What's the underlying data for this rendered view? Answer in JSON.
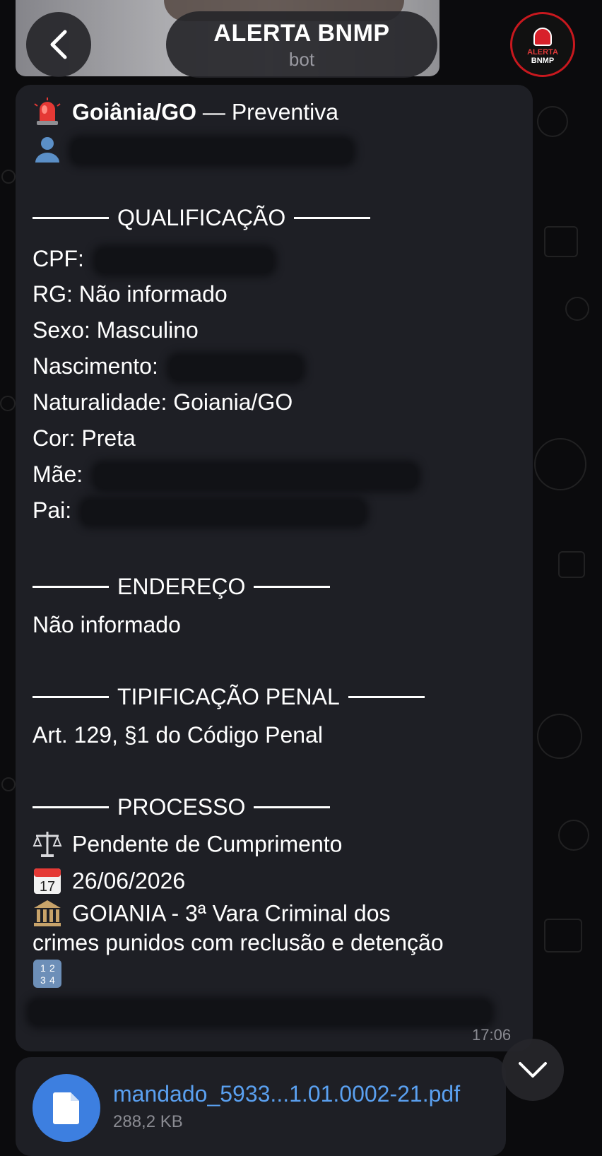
{
  "header": {
    "title": "ALERTA BNMP",
    "subtitle": "bot",
    "avatar_line1": "ALERTA",
    "avatar_line2": "BNMP",
    "back_icon": "chevron-left-icon"
  },
  "message": {
    "headline_city": "Goiânia/GO",
    "headline_rest": " — Preventiva",
    "sections": {
      "qualificacao": "QUALIFICAÇÃO",
      "endereco": "ENDEREÇO",
      "tipificacao": "TIPIFICAÇÃO PENAL",
      "processo": "PROCESSO"
    },
    "fields": {
      "cpf_label": "CPF:",
      "rg": "RG: Não informado",
      "sexo": "Sexo: Masculino",
      "nascimento_label": "Nascimento:",
      "naturalidade": "Naturalidade: Goiania/GO",
      "cor": "Cor: Preta",
      "mae_label": "Mãe:",
      "pai_label": "Pai:"
    },
    "endereco_value": "Não informado",
    "tipificacao_value": "Art. 129, §1 do Código Penal",
    "processo": {
      "status": "Pendente de Cumprimento",
      "calendar_day": "17",
      "date": "26/06/2026",
      "court_line1": "GOIANIA - 3ª Vara Criminal dos",
      "court_line2": "crimes punidos com reclusão e detenção"
    },
    "time": "17:06"
  },
  "file": {
    "name": "mandado_5933...1.01.0002-21.pdf",
    "size": "288,2 KB"
  },
  "colors": {
    "background": "#0b0b0d",
    "bubble": "#1e1f25",
    "link": "#5aa0f0",
    "accent_red": "#c8181e",
    "file_icon": "#3d7fe0"
  }
}
